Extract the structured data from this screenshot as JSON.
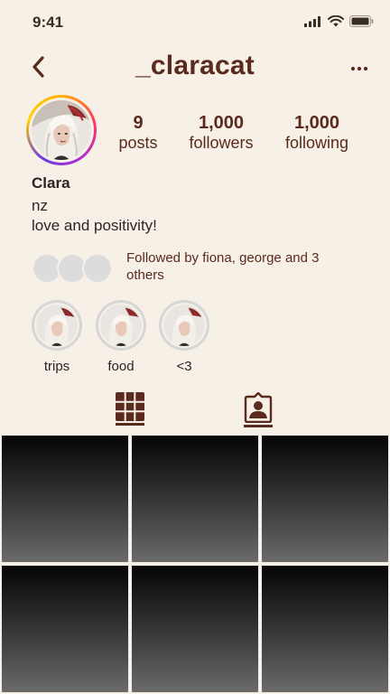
{
  "status_bar": {
    "time": "9:41",
    "icons": [
      "signal-icon",
      "wifi-icon",
      "battery-icon"
    ]
  },
  "header": {
    "username": "_claracat",
    "back_icon": "chevron-left-icon",
    "more_icon": "more-horizontal-icon"
  },
  "profile": {
    "avatar": "profile-photo",
    "stats": [
      {
        "value": "9",
        "label": "posts"
      },
      {
        "value": "1,000",
        "label": "followers"
      },
      {
        "value": "1,000",
        "label": "following"
      }
    ],
    "name": "Clara",
    "bio_lines": [
      "nz",
      "love and positivity!"
    ]
  },
  "followed_by": {
    "text": "Followed by fiona, george and 3 others",
    "avatar_count": 3
  },
  "highlights": [
    {
      "label": "trips"
    },
    {
      "label": "food"
    },
    {
      "label": "<3"
    }
  ],
  "tabs": [
    {
      "name": "grid",
      "icon": "grid-icon",
      "active": true
    },
    {
      "name": "tagged",
      "icon": "tagged-person-icon",
      "active": false
    }
  ],
  "colors": {
    "background": "#F7F0E6",
    "primary_text": "#5A2A1E",
    "dark_text": "#2B2523",
    "story_ring": [
      "#FFB000",
      "#FF3D5A",
      "#B02CD0"
    ]
  },
  "posts_count_visible": 6
}
